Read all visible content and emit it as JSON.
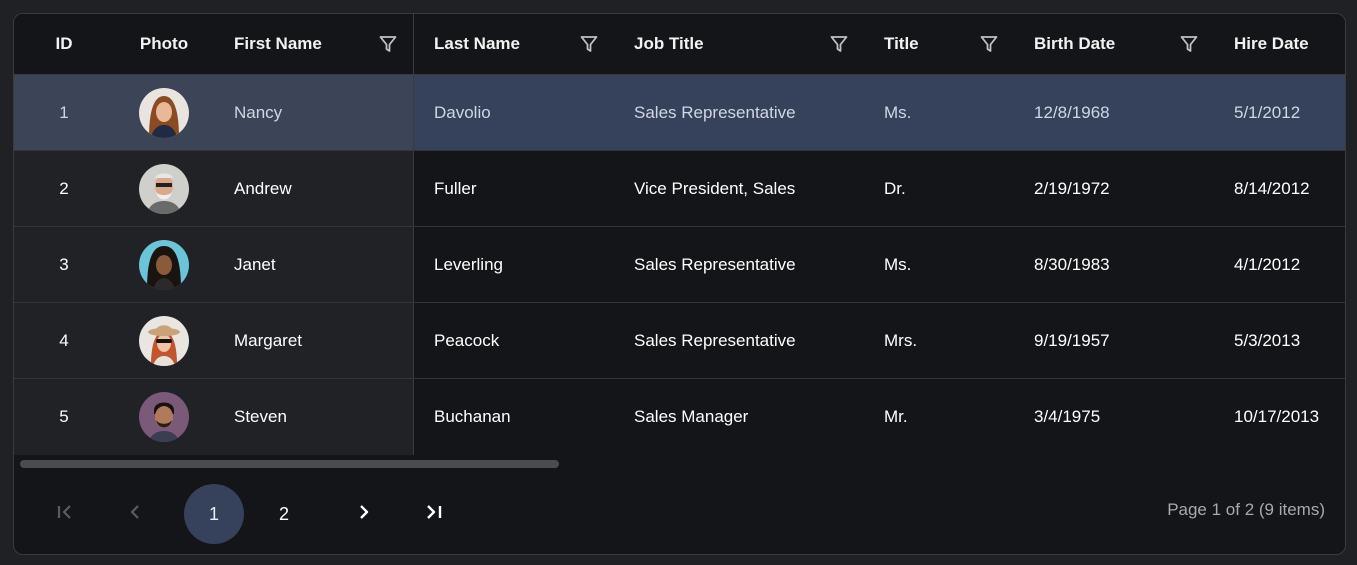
{
  "grid": {
    "columns": [
      {
        "key": "id",
        "label": "ID",
        "filterable": false
      },
      {
        "key": "photo",
        "label": "Photo",
        "filterable": false
      },
      {
        "key": "first_name",
        "label": "First Name",
        "filterable": true
      },
      {
        "key": "last_name",
        "label": "Last Name",
        "filterable": true
      },
      {
        "key": "job_title",
        "label": "Job Title",
        "filterable": true
      },
      {
        "key": "title",
        "label": "Title",
        "filterable": true
      },
      {
        "key": "birth_date",
        "label": "Birth Date",
        "filterable": true
      },
      {
        "key": "hire_date",
        "label": "Hire Date",
        "filterable": false
      }
    ],
    "rows": [
      {
        "id": "1",
        "photo": "avatar-nancy",
        "first_name": "Nancy",
        "last_name": "Davolio",
        "job_title": "Sales Representative",
        "title": "Ms.",
        "birth_date": "12/8/1968",
        "hire_date": "5/1/2012",
        "selected": true
      },
      {
        "id": "2",
        "photo": "avatar-andrew",
        "first_name": "Andrew",
        "last_name": "Fuller",
        "job_title": "Vice President, Sales",
        "title": "Dr.",
        "birth_date": "2/19/1972",
        "hire_date": "8/14/2012",
        "selected": false
      },
      {
        "id": "3",
        "photo": "avatar-janet",
        "first_name": "Janet",
        "last_name": "Leverling",
        "job_title": "Sales Representative",
        "title": "Ms.",
        "birth_date": "8/30/1983",
        "hire_date": "4/1/2012",
        "selected": false
      },
      {
        "id": "4",
        "photo": "avatar-margaret",
        "first_name": "Margaret",
        "last_name": "Peacock",
        "job_title": "Sales Representative",
        "title": "Mrs.",
        "birth_date": "9/19/1957",
        "hire_date": "5/3/2013",
        "selected": false
      },
      {
        "id": "5",
        "photo": "avatar-steven",
        "first_name": "Steven",
        "last_name": "Buchanan",
        "job_title": "Sales Manager",
        "title": "Mr.",
        "birth_date": "3/4/1975",
        "hire_date": "10/17/2013",
        "selected": false
      }
    ],
    "filter_icon": "filter-funnel-icon"
  },
  "pager": {
    "first_icon": "first-page-icon",
    "prev_icon": "previous-page-icon",
    "next_icon": "next-page-icon",
    "last_icon": "last-page-icon",
    "pages": [
      "1",
      "2"
    ],
    "current_page": "1",
    "info": "Page 1 of 2 (9 items)"
  },
  "colors": {
    "background": "#202124",
    "grid_bg": "#141518",
    "selected_row": "#36425b",
    "locked_column": "#202226",
    "border": "#3a3b3f",
    "muted_text": "#a7a9ae"
  }
}
